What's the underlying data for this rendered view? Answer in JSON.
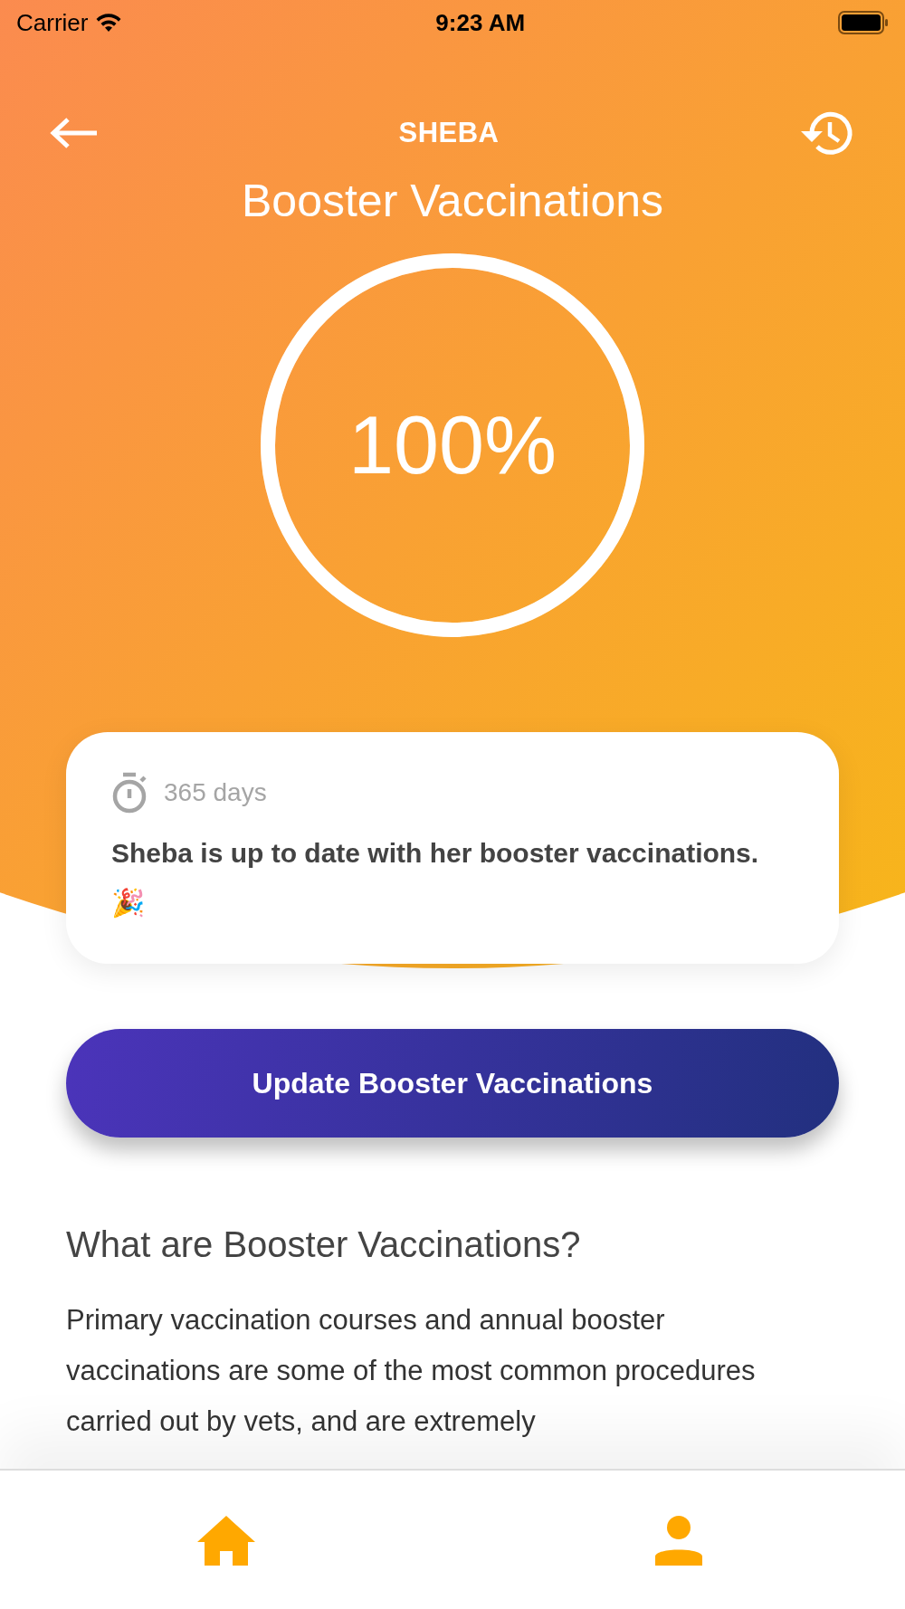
{
  "status_bar": {
    "carrier": "Carrier",
    "time": "9:23 AM"
  },
  "nav": {
    "title": "SHEBA"
  },
  "title": "Booster Vaccinations",
  "progress": {
    "level": 1,
    "reading": "100%"
  },
  "status_card": {
    "duration": "365 days",
    "message": "Sheba is up to date with her booster vaccinations. 🎉"
  },
  "action_button": "Update Booster Vaccinations",
  "info": {
    "heading": "What are Booster Vaccinations?",
    "body": "Primary vaccination courses and annual booster vaccinations are some of the most common procedures carried out by vets, and are extremely"
  },
  "tab_bar": [
    {
      "kind": "home"
    },
    {
      "kind": "profile"
    }
  ]
}
